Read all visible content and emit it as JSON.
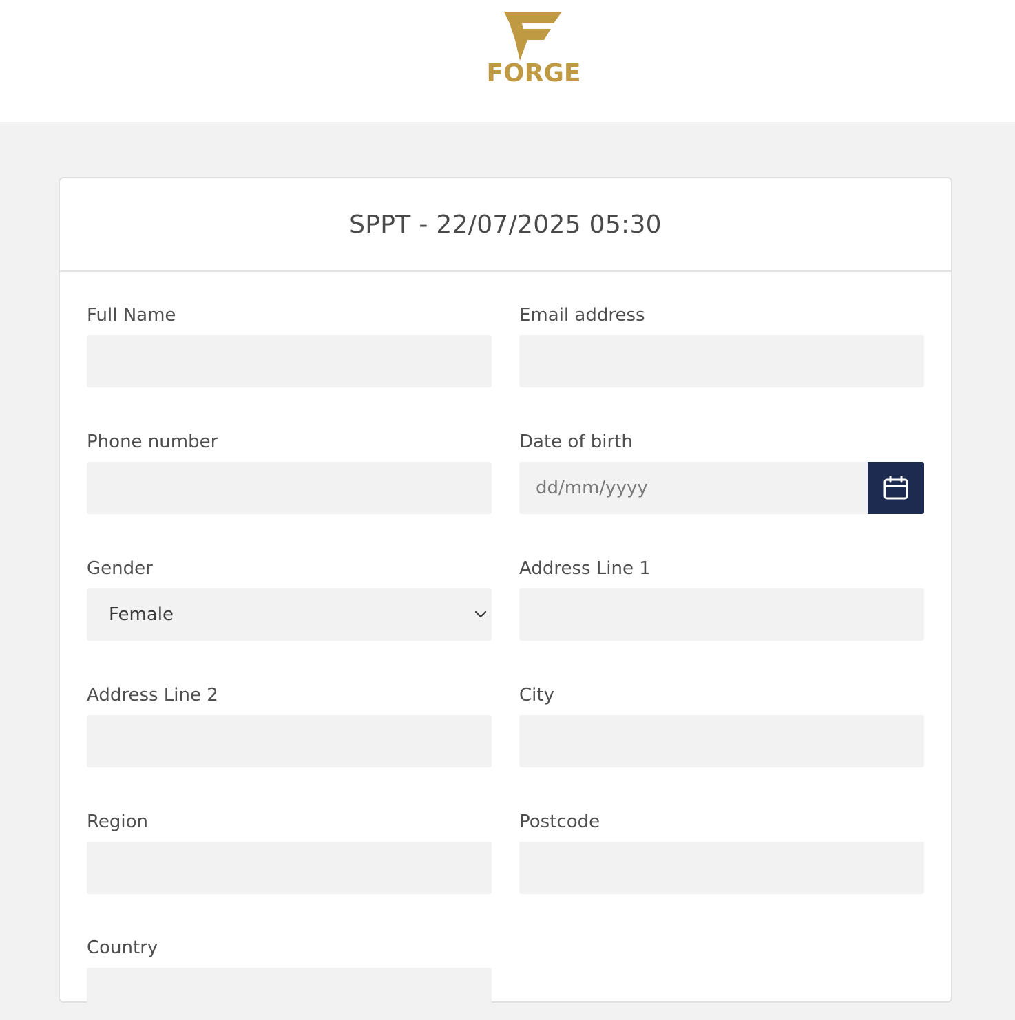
{
  "brand": {
    "name": "FORGE",
    "color": "#bf9a43"
  },
  "form": {
    "title": "SPPT - 22/07/2025 05:30",
    "full_name": {
      "label": "Full Name",
      "value": ""
    },
    "email": {
      "label": "Email address",
      "value": ""
    },
    "phone": {
      "label": "Phone number",
      "value": ""
    },
    "dob": {
      "label": "Date of birth",
      "placeholder": "dd/mm/yyyy",
      "icon": "calendar-icon"
    },
    "gender": {
      "label": "Gender",
      "selected": "Female",
      "icon": "chevron-down-icon"
    },
    "address1": {
      "label": "Address Line 1",
      "value": ""
    },
    "address2": {
      "label": "Address Line 2",
      "value": ""
    },
    "city": {
      "label": "City",
      "value": ""
    },
    "region": {
      "label": "Region",
      "value": ""
    },
    "postcode": {
      "label": "Postcode",
      "value": ""
    },
    "country": {
      "label": "Country"
    }
  },
  "colors": {
    "accent_dark": "#1c2b4f",
    "input_bg": "#f2f2f2"
  }
}
